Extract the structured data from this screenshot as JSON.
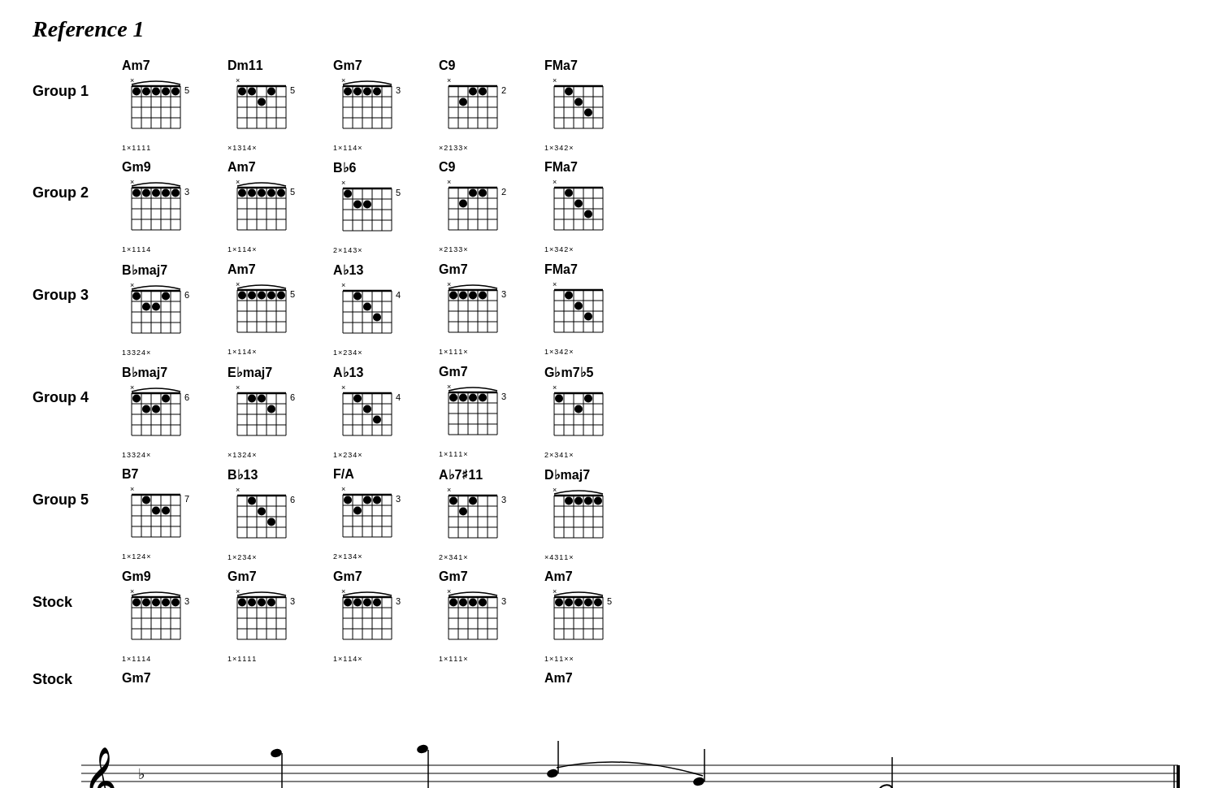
{
  "title": "Reference  1",
  "groups": [
    {
      "label": "Group 1",
      "chords": [
        {
          "name": "Am7",
          "fret": "5",
          "fingers": "1×1111",
          "mutes": "×",
          "barre": true
        },
        {
          "name": "Dm11",
          "fret": "5",
          "fingers": "×1314×",
          "mutes": "×",
          "barre": false
        },
        {
          "name": "Gm7",
          "fret": "3",
          "fingers": "1×114×",
          "mutes": "×",
          "barre": true
        },
        {
          "name": "C9",
          "fret": "2",
          "fingers": "×2133×",
          "mutes": "×",
          "barre": false
        },
        {
          "name": "FMa7",
          "fret": "",
          "fingers": "1×342×",
          "mutes": "×",
          "barre": false
        }
      ]
    },
    {
      "label": "Group 2",
      "chords": [
        {
          "name": "Gm9",
          "fret": "3",
          "fingers": "1×1114",
          "mutes": "×",
          "barre": true
        },
        {
          "name": "Am7",
          "fret": "5",
          "fingers": "1×114×",
          "mutes": "×",
          "barre": true
        },
        {
          "name": "B♭6",
          "fret": "5",
          "fingers": "2×143×",
          "mutes": "×",
          "barre": false
        },
        {
          "name": "C9",
          "fret": "2",
          "fingers": "×2133×",
          "mutes": "×",
          "barre": false
        },
        {
          "name": "FMa7",
          "fret": "",
          "fingers": "1×342×",
          "mutes": "×",
          "barre": false
        }
      ]
    },
    {
      "label": "Group 3",
      "chords": [
        {
          "name": "B♭maj7",
          "fret": "6",
          "fingers": "13324×",
          "mutes": "×",
          "barre": true
        },
        {
          "name": "Am7",
          "fret": "5",
          "fingers": "1×114×",
          "mutes": "×",
          "barre": true
        },
        {
          "name": "A♭13",
          "fret": "4",
          "fingers": "1×234×",
          "mutes": "×",
          "barre": false
        },
        {
          "name": "Gm7",
          "fret": "3",
          "fingers": "1×111×",
          "mutes": "×",
          "barre": true
        },
        {
          "name": "FMa7",
          "fret": "",
          "fingers": "1×342×",
          "mutes": "×",
          "barre": false
        }
      ]
    },
    {
      "label": "Group 4",
      "chords": [
        {
          "name": "B♭maj7",
          "fret": "6",
          "fingers": "13324×",
          "mutes": "×",
          "barre": true
        },
        {
          "name": "E♭maj7",
          "fret": "6",
          "fingers": "×1324×",
          "mutes": "×",
          "barre": false
        },
        {
          "name": "A♭13",
          "fret": "4",
          "fingers": "1×234×",
          "mutes": "×",
          "barre": false
        },
        {
          "name": "Gm7",
          "fret": "3",
          "fingers": "1×111×",
          "mutes": "×",
          "barre": true
        },
        {
          "name": "G♭m7♭5",
          "fret": "",
          "fingers": "2×341×",
          "mutes": "×",
          "barre": false
        }
      ]
    },
    {
      "label": "Group 5",
      "chords": [
        {
          "name": "B7",
          "fret": "7",
          "fingers": "1×124×",
          "mutes": "×",
          "barre": false
        },
        {
          "name": "B♭13",
          "fret": "6",
          "fingers": "1×234×",
          "mutes": "×",
          "barre": false
        },
        {
          "name": "F/A",
          "fret": "3",
          "fingers": "2×134×",
          "mutes": "×",
          "barre": false
        },
        {
          "name": "A♭7♯11",
          "fret": "3",
          "fingers": "2×341×",
          "mutes": "×",
          "barre": false
        },
        {
          "name": "D♭maj7",
          "fret": "",
          "fingers": "×4311×",
          "mutes": "×",
          "barre": true
        }
      ]
    },
    {
      "label": "Stock",
      "chords": [
        {
          "name": "Gm9",
          "fret": "3",
          "fingers": "1×1114",
          "mutes": "×",
          "barre": true
        },
        {
          "name": "Gm7",
          "fret": "3",
          "fingers": "1×1111",
          "mutes": "×",
          "barre": true
        },
        {
          "name": "Gm7",
          "fret": "3",
          "fingers": "1×114×",
          "mutes": "×",
          "barre": true
        },
        {
          "name": "Gm7",
          "fret": "3",
          "fingers": "1×111×",
          "mutes": "×",
          "barre": true
        },
        {
          "name": "Am7",
          "fret": "5",
          "fingers": "1×11××",
          "mutes": "××",
          "barre": true
        }
      ]
    }
  ],
  "stock_bottom_labels": [
    "Gm7",
    "",
    "",
    "",
    "Am7"
  ],
  "colors": {
    "background": "#ffffff",
    "text": "#000000",
    "grid": "#000000"
  }
}
